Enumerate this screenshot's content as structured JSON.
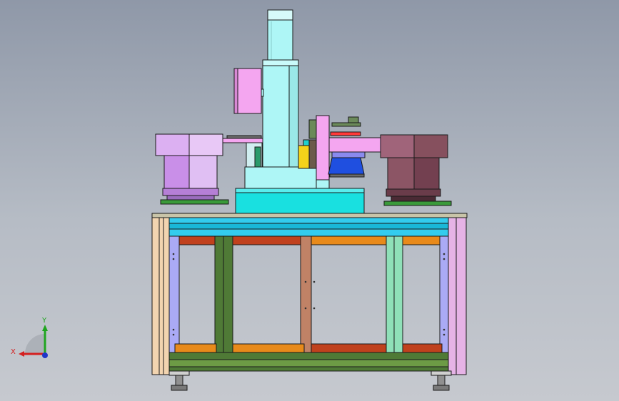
{
  "viewport": {
    "background_top": "#8f98a8",
    "background_bottom": "#c6c9cf"
  },
  "triad": {
    "x_label": "X",
    "y_label": "Y",
    "x_color": "#d42020",
    "y_color": "#1fa51f",
    "z_color": "#2036c8"
  },
  "colors": {
    "outline": "#1a1a1a",
    "frame_cyan": "#33ccee",
    "leg_left": "#f2d4b0",
    "leg_right": "#e6b3e6",
    "post_lavender": "#aaaaf5",
    "beam_orange": "#e88a1a",
    "beam_red": "#c0411d",
    "beam_green_dark": "#4f7a36",
    "beam_green_light": "#8fe0b8",
    "beam_brown": "#c08266",
    "column_light_cyan": "#aef6f6",
    "base_cyan": "#19e0e0",
    "motor_pink": "#f4a6f0",
    "feeder_left": "#c98fe8",
    "feeder_right": "#8c5565",
    "blue_block": "#1f4fe0",
    "pink_plate": "#ff66cc",
    "yellow_block": "#f4d21a",
    "table_top": "#c8c4a8"
  }
}
